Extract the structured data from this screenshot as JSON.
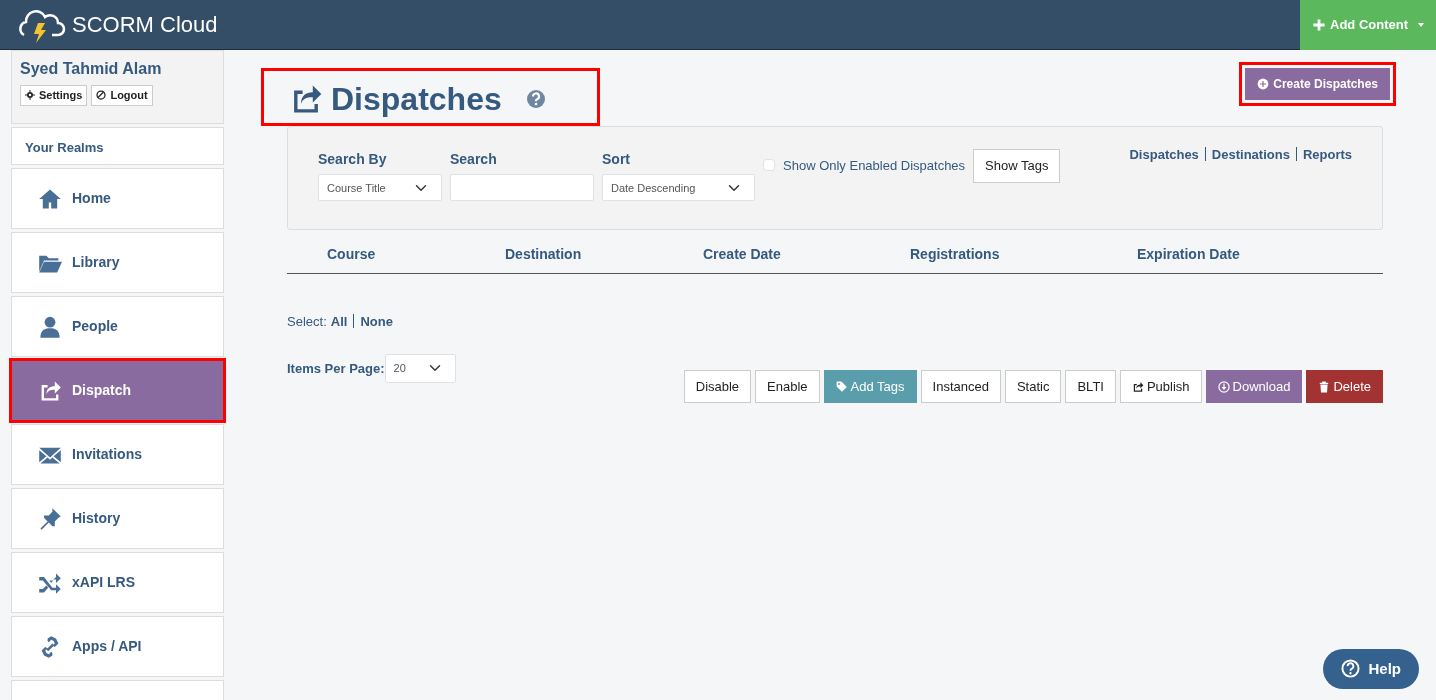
{
  "brand": {
    "name": "SCORM Cloud"
  },
  "add_content": {
    "label": "Add Content"
  },
  "user": {
    "name": "Syed Tahmid Alam",
    "buttons": [
      {
        "label": "Settings"
      },
      {
        "label": "Logout"
      }
    ]
  },
  "sidebar": {
    "heading": "Your Realms",
    "items": [
      {
        "label": "Home",
        "selected": false,
        "highlighted": false
      },
      {
        "label": "Library",
        "selected": false,
        "highlighted": false
      },
      {
        "label": "People",
        "selected": false,
        "highlighted": false
      },
      {
        "label": "Dispatch",
        "selected": true,
        "highlighted": true
      },
      {
        "label": "Invitations",
        "selected": false,
        "highlighted": false
      },
      {
        "label": "History",
        "selected": false,
        "highlighted": false
      },
      {
        "label": "xAPI LRS",
        "selected": false,
        "highlighted": false
      },
      {
        "label": "Apps / API",
        "selected": false,
        "highlighted": false
      },
      {
        "selected": false,
        "highlighted": false
      }
    ]
  },
  "page": {
    "title": "Dispatches",
    "highlighted": true
  },
  "create_button": {
    "label": "Create Dispatches",
    "highlighted": true
  },
  "filters": {
    "search_by": {
      "label": "Search By",
      "value": "Course Title"
    },
    "search": {
      "label": "Search"
    },
    "sort": {
      "label": "Sort",
      "value": "Date Descending"
    },
    "enabled_only": {
      "label": "Show Only Enabled Dispatches",
      "checked": false
    },
    "show_tags": "Show Tags"
  },
  "links": [
    "Dispatches",
    "Destinations",
    "Reports"
  ],
  "table": {
    "columns": [
      "Course",
      "Destination",
      "Create Date",
      "Registrations",
      "Expiration Date"
    ]
  },
  "select": {
    "label": "Select:",
    "options": [
      "All",
      "None"
    ]
  },
  "items_per_page": {
    "label": "Items Per Page:",
    "value": "20"
  },
  "actions": [
    {
      "label": "Disable",
      "kind": "plain"
    },
    {
      "label": "Enable",
      "kind": "plain"
    },
    {
      "label": "Add Tags",
      "kind": "info"
    },
    {
      "label": "Instanced",
      "kind": "plain"
    },
    {
      "label": "Static",
      "kind": "plain"
    },
    {
      "label": "BLTI",
      "kind": "plain"
    },
    {
      "label": "Publish",
      "kind": "plain"
    },
    {
      "label": "Download",
      "kind": "purple"
    },
    {
      "label": "Delete",
      "kind": "danger"
    }
  ],
  "help": {
    "label": "Help"
  }
}
